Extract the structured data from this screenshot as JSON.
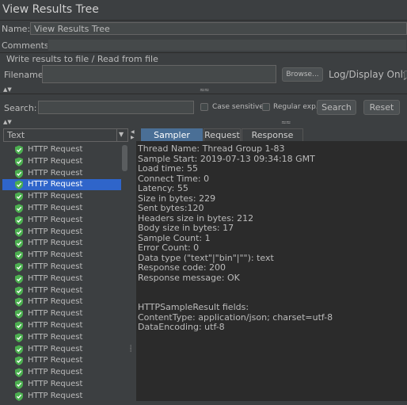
{
  "window": {
    "title": "View Results Tree"
  },
  "form": {
    "name_label": "Name:",
    "name_value": "View Results Tree",
    "comments_label": "Comments:",
    "comments_value": "",
    "write_results_label": "Write results to file / Read from file",
    "filename_label": "Filename",
    "filename_value": "",
    "browse_label": "Browse...",
    "log_display_label": "Log/Display Only:"
  },
  "search": {
    "label": "Search:",
    "value": "",
    "case_sensitive_label": "Case sensitive",
    "regular_exp_label": "Regular exp.",
    "search_button": "Search",
    "reset_button": "Reset"
  },
  "renderer": {
    "selected": "Text"
  },
  "tree": {
    "items": [
      {
        "label": "HTTP Request",
        "selected": false
      },
      {
        "label": "HTTP Request",
        "selected": false
      },
      {
        "label": "HTTP Request",
        "selected": false
      },
      {
        "label": "HTTP Request",
        "selected": true
      },
      {
        "label": "HTTP Request",
        "selected": false
      },
      {
        "label": "HTTP Request",
        "selected": false
      },
      {
        "label": "HTTP Request",
        "selected": false
      },
      {
        "label": "HTTP Request",
        "selected": false
      },
      {
        "label": "HTTP Request",
        "selected": false
      },
      {
        "label": "HTTP Request",
        "selected": false
      },
      {
        "label": "HTTP Request",
        "selected": false
      },
      {
        "label": "HTTP Request",
        "selected": false
      },
      {
        "label": "HTTP Request",
        "selected": false
      },
      {
        "label": "HTTP Request",
        "selected": false
      },
      {
        "label": "HTTP Request",
        "selected": false
      },
      {
        "label": "HTTP Request",
        "selected": false
      },
      {
        "label": "HTTP Request",
        "selected": false
      },
      {
        "label": "HTTP Request",
        "selected": false
      },
      {
        "label": "HTTP Request",
        "selected": false
      },
      {
        "label": "HTTP Request",
        "selected": false
      },
      {
        "label": "HTTP Request",
        "selected": false
      },
      {
        "label": "HTTP Request",
        "selected": false
      }
    ]
  },
  "tabs": [
    {
      "label": "Sampler result",
      "active": true
    },
    {
      "label": "Request",
      "active": false
    },
    {
      "label": "Response data",
      "active": false
    }
  ],
  "result": {
    "lines": [
      "Thread Name: Thread Group 1-83",
      "Sample Start: 2019-07-13 09:34:18 GMT",
      "Load time: 55",
      "Connect Time: 0",
      "Latency: 55",
      "Size in bytes: 229",
      "Sent bytes:120",
      "Headers size in bytes: 212",
      "Body size in bytes: 17",
      "Sample Count: 1",
      "Error Count: 0",
      "Data type (\"text\"|\"bin\"|\"\"): text",
      "Response code: 200",
      "Response message: OK",
      "",
      "",
      "HTTPSampleResult fields:",
      "ContentType: application/json; charset=utf-8",
      "DataEncoding: utf-8"
    ]
  },
  "colors": {
    "background": "#3c3f41",
    "result_background": "#2b2b2b",
    "selection": "#2f65ca",
    "active_tab": "#4a6f96",
    "shield_icon": "#4caf50"
  },
  "icons": {
    "tree_item": "success-shield-icon",
    "dropdown": "triangle-down-icon",
    "collapse": "triangle-up-down-icon"
  }
}
